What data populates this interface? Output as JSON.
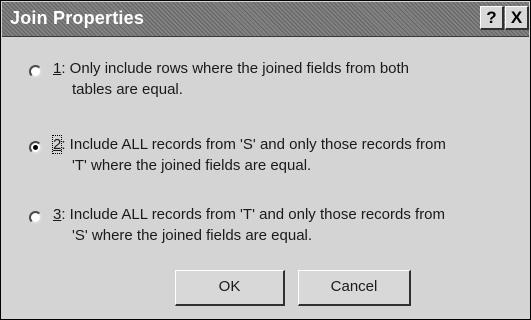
{
  "window": {
    "title": "Join Properties",
    "help_label": "?",
    "close_label": "X"
  },
  "options": [
    {
      "number": "1",
      "line1": ": Only include rows where the joined fields from both",
      "line2": "tables are equal.",
      "selected": false
    },
    {
      "number": "2",
      "line1": ": Include ALL records from 'S' and only those records from",
      "line2": "'T' where the joined fields are equal.",
      "selected": true
    },
    {
      "number": "3",
      "line1": ": Include ALL records from 'T' and only those records from",
      "line2": "'S' where the joined fields are equal.",
      "selected": false
    }
  ],
  "buttons": {
    "ok": "OK",
    "cancel": "Cancel"
  }
}
